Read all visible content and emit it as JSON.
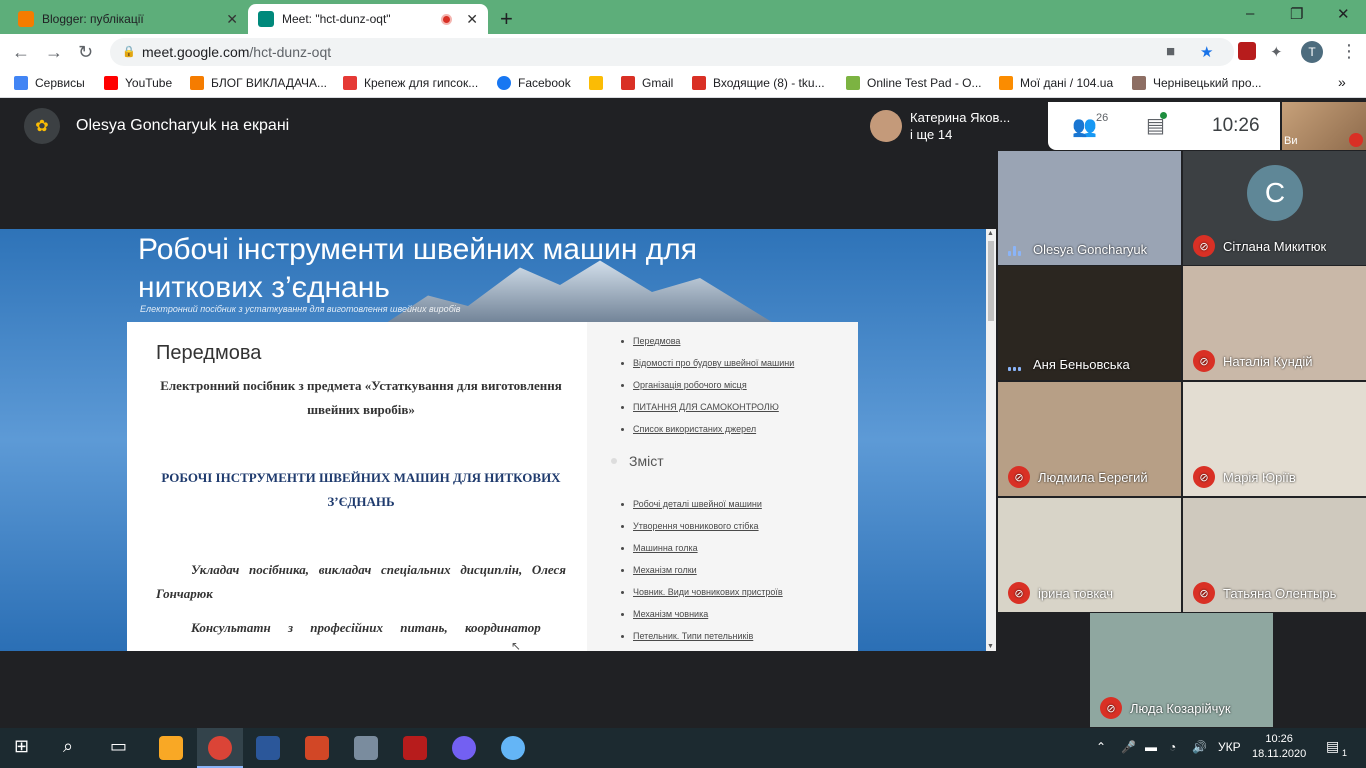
{
  "browser": {
    "tabs": [
      {
        "title": "Blogger: публікації",
        "favicon": "blogger-icon",
        "color": "#f57c00"
      },
      {
        "title": "Meet: \"hct-dunz-oqt\"",
        "favicon": "meet-icon",
        "color": "#00897b"
      }
    ],
    "window_controls": {
      "minimize": "–",
      "maximize": "❐",
      "close": "✕"
    },
    "new_tab": "+",
    "url_host": "meet.google.com",
    "url_path": "/hct-dunz-oqt",
    "profile_initial": "T",
    "bookmarks": [
      {
        "label": "Сервисы",
        "icon": "apps-grid-icon",
        "color": "#4285f4"
      },
      {
        "label": "YouTube",
        "icon": "youtube-icon",
        "color": "#ff0000"
      },
      {
        "label": "БЛОГ ВИКЛАДАЧА...",
        "icon": "blogger-icon",
        "color": "#f57c00"
      },
      {
        "label": "Крепеж для гипсок...",
        "icon": "house-icon",
        "color": "#e53935"
      },
      {
        "label": "Facebook",
        "icon": "facebook-icon",
        "color": "#1877f2"
      },
      {
        "label": "",
        "icon": "yellow-doc-icon",
        "color": "#fbbc04"
      },
      {
        "label": "Gmail",
        "icon": "gmail-icon",
        "color": "#d93025"
      },
      {
        "label": "Входящие (8) - tku...",
        "icon": "gmail-icon",
        "color": "#d93025"
      },
      {
        "label": "Online Test Pad - О...",
        "icon": "testpad-icon",
        "color": "#7cb342"
      },
      {
        "label": "Мої дані / 104.ua",
        "icon": "number-104-icon",
        "color": "#fb8c00"
      },
      {
        "label": "Чернівецький про...",
        "icon": "school-icon",
        "color": "#8d6e63"
      }
    ],
    "bookmarks_more": "»"
  },
  "meet": {
    "presenter_text": "Olesya Goncharyuk на екрані",
    "top_participant_name": "Катерина Яков...",
    "top_participant_more": "і ще 14",
    "participants_count": "26",
    "time": "10:26",
    "self_label": "Ви",
    "shared_screen": {
      "site_title": "Робочі інструменти швейних машин для ниткових з’єднань",
      "site_subtitle": "Електронний посібник з устаткування для виготовлення швейних виробів",
      "doc_heading": "Передмова",
      "doc_intro": "Електронний посібник з предмета «Устаткування для виготовлення швейних виробів»",
      "doc_caps": "РОБОЧІ ІНСТРУМЕНТИ ШВЕЙНИХ МАШИН ДЛЯ НИТКОВИХ З’ЄДНАНЬ",
      "doc_author": "Укладач посібника, викладач спеціальних дисциплін, Олеся Гончарюк",
      "doc_consult": "Консультатн з професійних питань, координатор",
      "nav_top": [
        "Передмова",
        "Відомості про будову швейної машини",
        "Організація робочого місця",
        "ПИТАННЯ ДЛЯ САМОКОНТРОЛЮ",
        "Список використаних джерел"
      ],
      "nav_heading": "Зміст",
      "nav_content": [
        "Робочі деталі швейної машини",
        "Утворення човникового стібка",
        "Машинна голка",
        "Механізм голки",
        "Човник. Види човникових пристроїв",
        "Механізм човника",
        "Петельник. Типи петельників"
      ]
    },
    "tiles": [
      {
        "name": "Olesya Goncharyuk",
        "status": "speaking",
        "bg": "#9aa4b4"
      },
      {
        "name": "Сітлана Микитюк",
        "status": "muted",
        "bg": "#3c4043",
        "letter": "С"
      },
      {
        "name": "Аня Беньовська",
        "status": "speaking",
        "bg": "#2b2620"
      },
      {
        "name": "Наталія Кундій",
        "status": "muted",
        "bg": "#c9b8a8"
      },
      {
        "name": "Людмила Берегий",
        "status": "muted",
        "bg": "#b79f86"
      },
      {
        "name": "Марія Юріїв",
        "status": "muted",
        "bg": "#e3ddd2"
      },
      {
        "name": "ірина товкач",
        "status": "muted",
        "bg": "#d8d4c8"
      },
      {
        "name": "Татьяна Олентырь",
        "status": "muted",
        "bg": "#cfc9be"
      },
      {
        "name": "Люда Козарійчук",
        "status": "muted",
        "bg": "#8fa7a0"
      }
    ]
  },
  "taskbar": {
    "start_icon": "windows-start-icon",
    "tray_lang": "УКР",
    "clock_time": "10:26",
    "clock_date": "18.11.2020",
    "notifications_count": "1"
  }
}
